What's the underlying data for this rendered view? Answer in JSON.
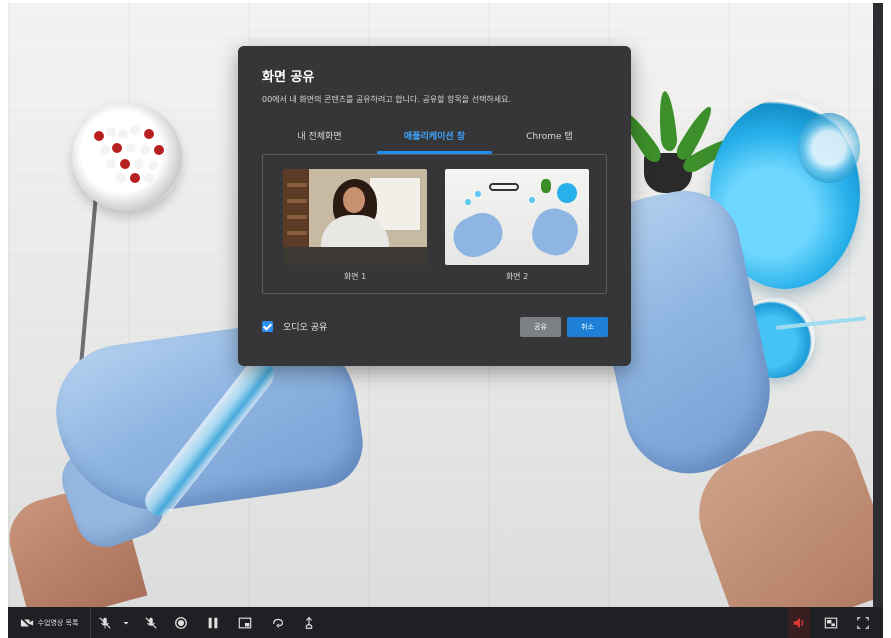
{
  "dialog": {
    "title": "화면 공유",
    "description": "00에서 내 화면의 콘텐츠를 공유하려고 합니다. 공유할 항목을 선택하세요.",
    "tabs": [
      {
        "label": "내 전체화면",
        "active": false
      },
      {
        "label": "애플리케이션 창",
        "active": true
      },
      {
        "label": "Chrome 탭",
        "active": false
      }
    ],
    "windows": [
      {
        "label": "화면 1"
      },
      {
        "label": "화면 2"
      }
    ],
    "audio_share": {
      "label": "오디오 공유",
      "checked": true
    },
    "share_button": "공유",
    "cancel_button": "취소"
  },
  "toolbar": {
    "list_label": "수업영상 목록",
    "icons": [
      "video-camera-off-icon",
      "microphone-off-icon",
      "chevron-down-icon",
      "speaker-off-icon",
      "record-icon",
      "pause-icon",
      "picture-in-picture-icon",
      "rotate-icon",
      "hand-icon",
      "volume-muted-icon",
      "screen-share-icon",
      "fullscreen-icon"
    ]
  },
  "colors": {
    "dialog_bg": "#363638",
    "accent_blue": "#1f8ef1",
    "share_btn": "#7c7f83",
    "cancel_btn": "#1d7fd6",
    "toolbar_bg": "#1f2023",
    "mute_red": "#e03a3a"
  }
}
